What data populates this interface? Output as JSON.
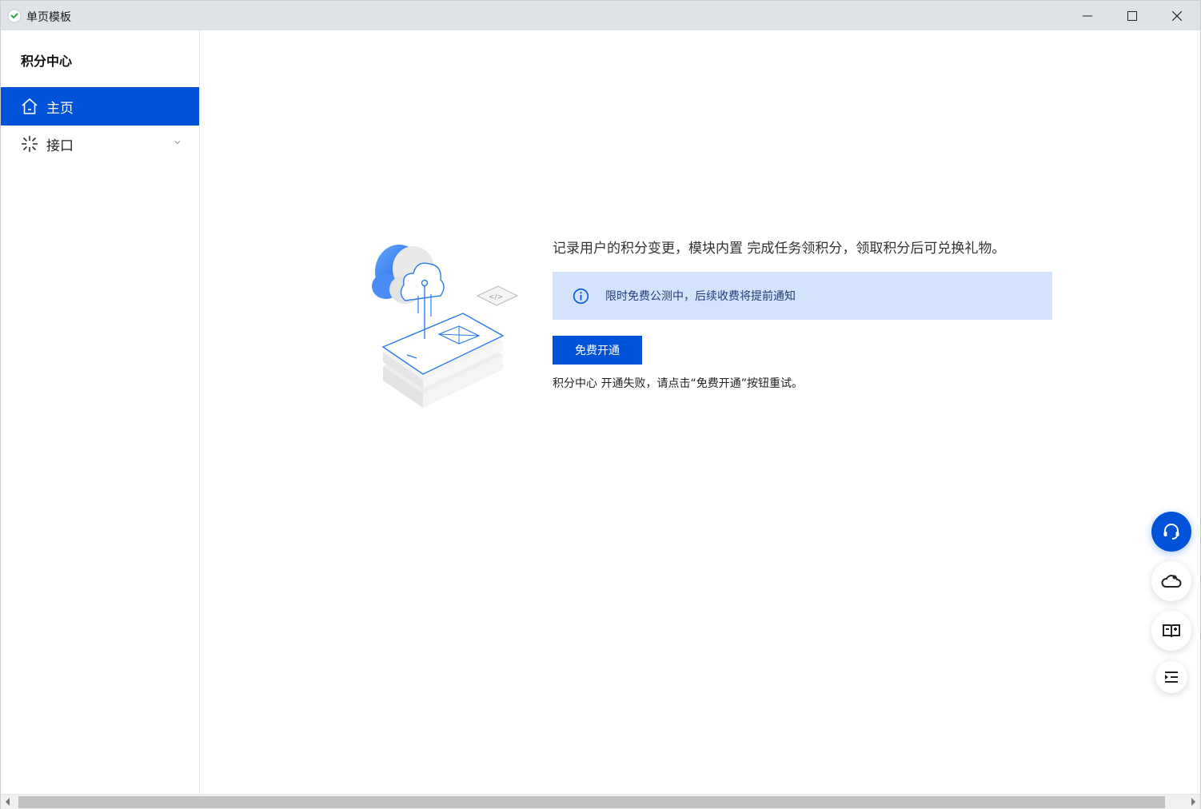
{
  "window": {
    "title": "单页模板"
  },
  "sidebar": {
    "title": "积分中心",
    "items": [
      {
        "label": "主页",
        "icon": "home-icon",
        "active": true
      },
      {
        "label": "接口",
        "icon": "api-icon",
        "expandable": true
      }
    ]
  },
  "main": {
    "description": "记录用户的积分变更，模块内置 完成任务领积分，领取积分后可兑换礼物。",
    "notice": "限时免费公测中，后续收费将提前通知",
    "button_label": "免费开通",
    "error_text": "积分中心 开通失败，请点击“免费开通”按钮重试。"
  },
  "floating_buttons": [
    "headset-icon",
    "cloud-icon",
    "book-icon",
    "collapse-icon"
  ],
  "colors": {
    "primary": "#0052d9",
    "notice_bg": "#d4e3fc",
    "titlebar_bg": "#dfe3e8"
  }
}
